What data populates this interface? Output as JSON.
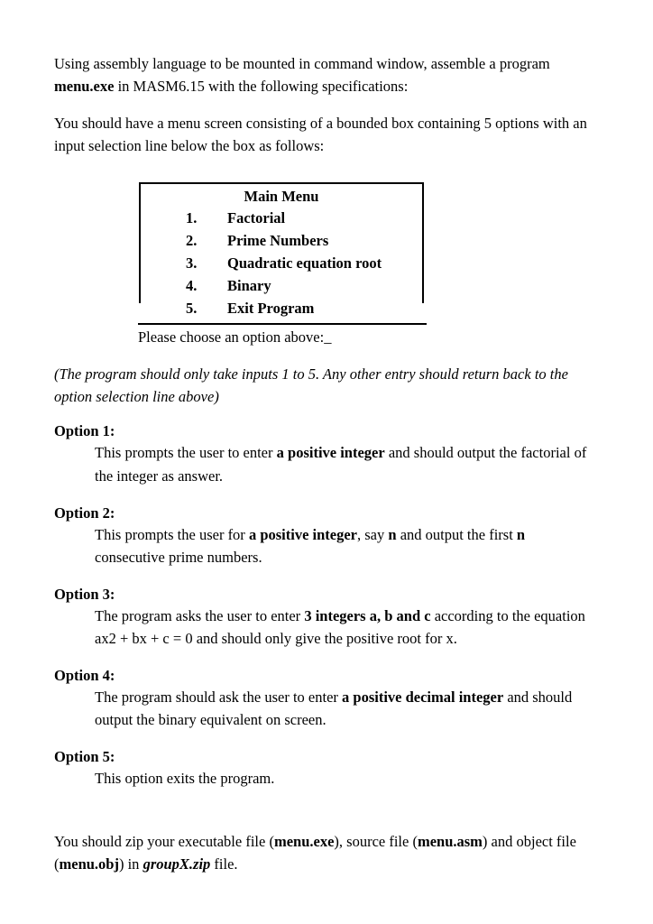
{
  "document": {
    "intro": {
      "line1_a": "Using assembly language to be mounted in command window, assemble a program ",
      "line1_b": "menu.exe",
      "line1_c": " in MASM6.15 with the following specifications:",
      "line2": "You should have a menu screen consisting of a bounded box containing 5 options with an input selection line below the box as follows:"
    },
    "menu": {
      "title": "Main Menu",
      "items": [
        {
          "number": "1.",
          "label": "Factorial"
        },
        {
          "number": "2.",
          "label": "Prime Numbers"
        },
        {
          "number": "3.",
          "label": "Quadratic equation root"
        },
        {
          "number": "4.",
          "label": "Binary"
        },
        {
          "number": "5.",
          "label": "Exit Program"
        }
      ],
      "prompt": "Please choose an option above:",
      "cursor": "_"
    },
    "note": "(The program should only take inputs 1 to 5. Any other entry should return back to the option selection line above)",
    "options": [
      {
        "heading": "Option 1:",
        "body_a": "This prompts the user to enter ",
        "body_b": "a positive integer",
        "body_c": " and should output the factorial of the integer as answer.",
        "body_d": "",
        "body_e": "",
        "body_f": ""
      },
      {
        "heading": "Option 2:",
        "body_a": "This prompts the user for ",
        "body_b": "a positive integer",
        "body_c": ", say ",
        "body_d": "n",
        "body_e": " and output the first ",
        "body_f": "n",
        "body_g": " consecutive prime numbers."
      },
      {
        "heading": "Option 3:",
        "body_a": "The program asks the user to enter ",
        "body_b": "3 integers a, b and c",
        "body_c": " according to the equation ax2 + bx + c = 0 and should only give the positive root for x."
      },
      {
        "heading": "Option 4:",
        "body_a": "The program should ask the user to enter ",
        "body_b": "a positive decimal integer",
        "body_c": " and should output the binary equivalent on screen."
      },
      {
        "heading": "Option 5:",
        "body_a": "This option exits the program.",
        "body_b": "",
        "body_c": ""
      }
    ],
    "closing": {
      "a": "You should zip your executable file (",
      "b": "menu.exe",
      "c": "), source file (",
      "d": "menu.asm",
      "e": ") and object file (",
      "f": "menu.obj",
      "g": ") in ",
      "h": "groupX.zip",
      "i": " file."
    }
  }
}
